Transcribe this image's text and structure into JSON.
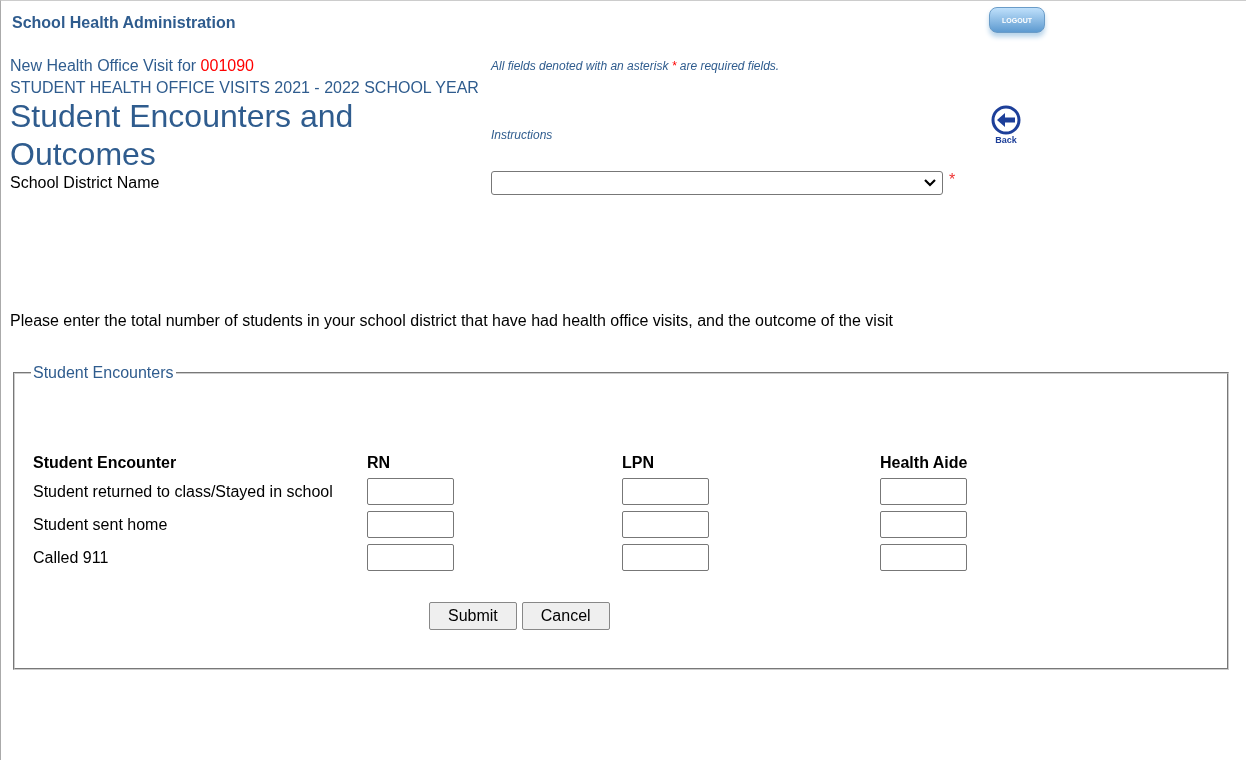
{
  "app_title": "School Health Administration",
  "logout_button": "LOGOUT",
  "visit_label": "New Health Office Visit for",
  "student_id": "001090",
  "required_note": {
    "before": "All fields denoted with an asterisk",
    "asterisk": "*",
    "after": "are required fields."
  },
  "subtitle": "STUDENT HEALTH OFFICE VISITS 2021 - 2022  SCHOOL YEAR",
  "heading": "Student Encounters and Outcomes",
  "instructions_link": "Instructions",
  "back_button": "Back",
  "district_field": {
    "label": "School District Name",
    "required_mark": "*"
  },
  "prompt": "Please enter the total number of students in your school district that have had health office visits, and the outcome of the visit",
  "encounters": {
    "legend": "Student Encounters",
    "columns": [
      "Student Encounter",
      "RN",
      "LPN",
      "Health Aide"
    ],
    "rows": [
      "Student returned to class/Stayed in school",
      "Student sent home",
      "Called 911"
    ]
  },
  "buttons": [
    "Submit",
    "Cancel"
  ]
}
